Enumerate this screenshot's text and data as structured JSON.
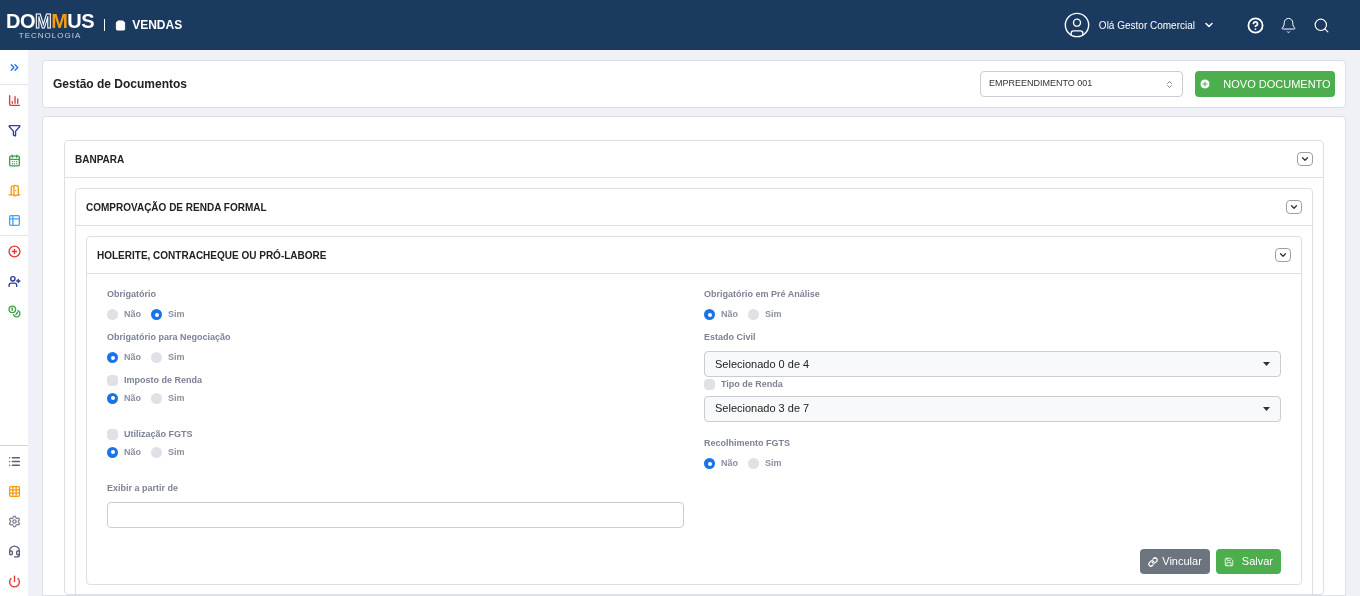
{
  "header": {
    "logo": {
      "parts": [
        {
          "text": "DO",
          "kind": "plain"
        },
        {
          "text": "M",
          "kind": "outline"
        },
        {
          "text": "M",
          "kind": "accent"
        },
        {
          "text": "US",
          "kind": "plain"
        }
      ],
      "tagline": "TECNOLOGIA"
    },
    "module": "VENDAS",
    "user": "Olá Gestor Comercial"
  },
  "page": {
    "title": "Gestão de Documentos",
    "select": "EMPREENDIMENTO 001",
    "new_button": "NOVO DOCUMENTO"
  },
  "panel": {
    "title": "BANPARA",
    "expanded": true,
    "child": {
      "title": "COMPROVAÇÃO DE RENDA FORMAL",
      "expanded": true,
      "child": {
        "title": "HOLERITE, CONTRACHEQUE OU PRÓ-LABORE",
        "expanded": true,
        "left": [
          {
            "kind": "radio",
            "label": "Obrigatório",
            "options": [
              {
                "label": "Não",
                "selected": false
              },
              {
                "label": "Sim",
                "selected": true
              }
            ]
          },
          {
            "kind": "radio",
            "label": "Obrigatório para Negociação",
            "options": [
              {
                "label": "Não",
                "selected": true
              },
              {
                "label": "Sim",
                "selected": false
              }
            ]
          },
          {
            "kind": "check_radio",
            "label": "Imposto de Renda",
            "checked": false,
            "options": [
              {
                "label": "Não",
                "selected": true
              },
              {
                "label": "Sim",
                "selected": false
              }
            ]
          },
          {
            "kind": "check_radio",
            "label": "Utilização FGTS",
            "checked": false,
            "options": [
              {
                "label": "Não",
                "selected": true
              },
              {
                "label": "Sim",
                "selected": false
              }
            ]
          },
          {
            "kind": "input",
            "label": "Exibir a partir de"
          }
        ],
        "right": [
          {
            "kind": "radio",
            "label": "Obrigatório em Pré Análise",
            "options": [
              {
                "label": "Não",
                "selected": true
              },
              {
                "label": "Sim",
                "selected": false
              }
            ]
          },
          {
            "kind": "select",
            "label": "Estado Civil",
            "value": "Selecionado 0 de 4"
          },
          {
            "kind": "check_select",
            "label": "Tipo de Renda",
            "checked": false,
            "value": "Selecionado 3 de 7"
          },
          {
            "kind": "radio",
            "label": "Recolhimento FGTS",
            "options": [
              {
                "label": "Não",
                "selected": true
              },
              {
                "label": "Sim",
                "selected": false
              }
            ]
          }
        ],
        "buttons": [
          {
            "label": "Vincular",
            "kind": "link"
          },
          {
            "label": "Salvar",
            "kind": "save"
          }
        ]
      }
    }
  }
}
